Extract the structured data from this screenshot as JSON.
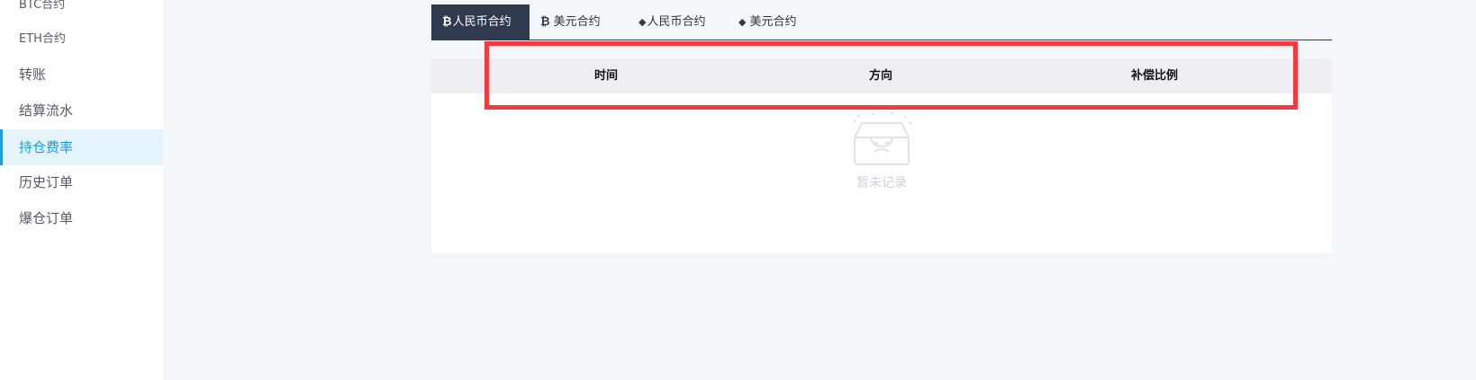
{
  "sidebar": {
    "items": [
      {
        "label": "BTC合约"
      },
      {
        "label": "ETH合约"
      },
      {
        "label": "转账"
      },
      {
        "label": "结算流水"
      },
      {
        "label": "持仓费率"
      },
      {
        "label": "历史订单"
      },
      {
        "label": "爆仓订单"
      }
    ],
    "active_index": 4
  },
  "tabs": [
    {
      "icon": "bitcoin-icon",
      "label": "人民币合约",
      "active": true
    },
    {
      "icon": "bitcoin-icon",
      "label": "美元合约",
      "active": false
    },
    {
      "icon": "ethereum-icon",
      "label": "人民币合约",
      "active": false
    },
    {
      "icon": "ethereum-icon",
      "label": "美元合约",
      "active": false
    }
  ],
  "table": {
    "columns": [
      "时间",
      "方向",
      "补偿比例"
    ],
    "rows": [],
    "empty_text": "暂未记录"
  },
  "colors": {
    "active_tab_bg": "#2f3a4f",
    "sidebar_active": "#1f9bd7",
    "highlight": "#f23b3f"
  }
}
